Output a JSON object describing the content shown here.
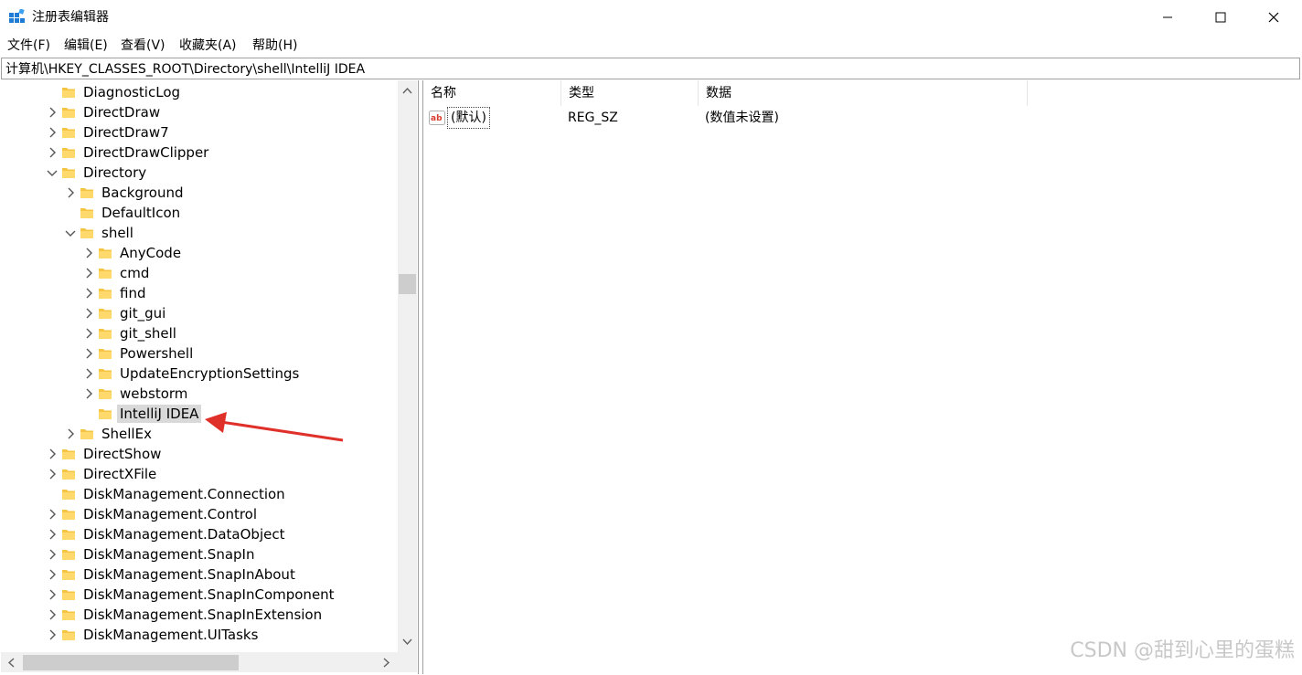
{
  "window": {
    "title": "注册表编辑器",
    "icon": "regedit-icon",
    "minimize_icon": "minimize-icon",
    "maximize_icon": "maximize-icon",
    "close_icon": "close-icon"
  },
  "menu": [
    "文件(F)",
    "编辑(E)",
    "查看(V)",
    "收藏夹(A)",
    "帮助(H)"
  ],
  "address": "计算机\\HKEY_CLASSES_ROOT\\Directory\\shell\\IntelliJ IDEA",
  "tree": [
    {
      "label": "DiagnosticLog",
      "level": 0,
      "expander": "none"
    },
    {
      "label": "DirectDraw",
      "level": 0,
      "expander": "collapsed"
    },
    {
      "label": "DirectDraw7",
      "level": 0,
      "expander": "collapsed"
    },
    {
      "label": "DirectDrawClipper",
      "level": 0,
      "expander": "collapsed"
    },
    {
      "label": "Directory",
      "level": 0,
      "expander": "expanded"
    },
    {
      "label": "Background",
      "level": 1,
      "expander": "collapsed"
    },
    {
      "label": "DefaultIcon",
      "level": 1,
      "expander": "none"
    },
    {
      "label": "shell",
      "level": 1,
      "expander": "expanded"
    },
    {
      "label": "AnyCode",
      "level": 2,
      "expander": "collapsed"
    },
    {
      "label": "cmd",
      "level": 2,
      "expander": "collapsed"
    },
    {
      "label": "find",
      "level": 2,
      "expander": "collapsed"
    },
    {
      "label": "git_gui",
      "level": 2,
      "expander": "collapsed"
    },
    {
      "label": "git_shell",
      "level": 2,
      "expander": "collapsed"
    },
    {
      "label": "Powershell",
      "level": 2,
      "expander": "collapsed"
    },
    {
      "label": "UpdateEncryptionSettings",
      "level": 2,
      "expander": "collapsed"
    },
    {
      "label": "webstorm",
      "level": 2,
      "expander": "collapsed"
    },
    {
      "label": "IntelliJ IDEA",
      "level": 2,
      "expander": "none",
      "selected": true
    },
    {
      "label": "ShellEx",
      "level": 1,
      "expander": "collapsed"
    },
    {
      "label": "DirectShow",
      "level": 0,
      "expander": "collapsed"
    },
    {
      "label": "DirectXFile",
      "level": 0,
      "expander": "collapsed"
    },
    {
      "label": "DiskManagement.Connection",
      "level": 0,
      "expander": "none"
    },
    {
      "label": "DiskManagement.Control",
      "level": 0,
      "expander": "collapsed"
    },
    {
      "label": "DiskManagement.DataObject",
      "level": 0,
      "expander": "collapsed"
    },
    {
      "label": "DiskManagement.SnapIn",
      "level": 0,
      "expander": "collapsed"
    },
    {
      "label": "DiskManagement.SnapInAbout",
      "level": 0,
      "expander": "collapsed"
    },
    {
      "label": "DiskManagement.SnapInComponent",
      "level": 0,
      "expander": "collapsed"
    },
    {
      "label": "DiskManagement.SnapInExtension",
      "level": 0,
      "expander": "collapsed"
    },
    {
      "label": "DiskManagement.UITasks",
      "level": 0,
      "expander": "collapsed"
    }
  ],
  "list": {
    "columns": [
      "名称",
      "类型",
      "数据"
    ],
    "rows": [
      {
        "name": "(默认)",
        "type": "REG_SZ",
        "data": "(数值未设置)",
        "icon": "string-value-icon"
      }
    ]
  },
  "watermark": "CSDN @甜到心里的蛋糕",
  "colors": {
    "folder": "#f4c542",
    "selection": "#d9d9d9",
    "annotation_arrow": "#e0302a"
  }
}
